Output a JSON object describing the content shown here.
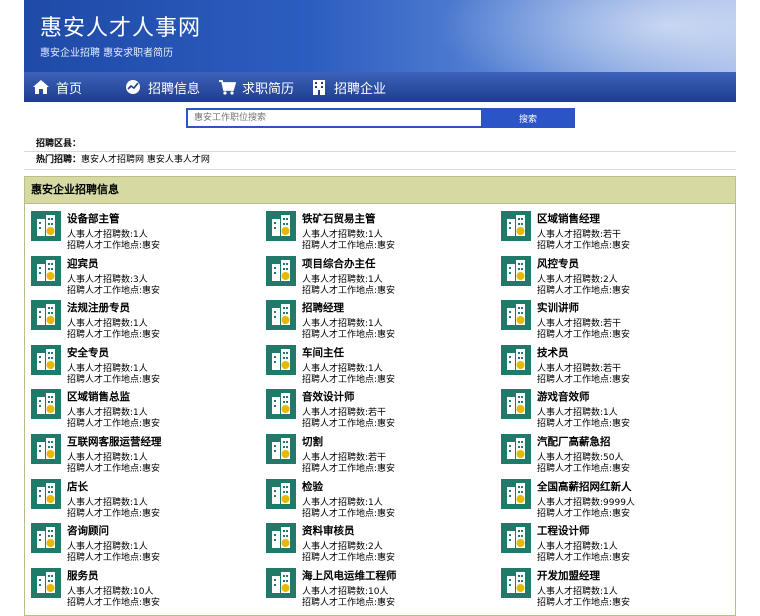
{
  "header": {
    "title": "惠安人才人事网",
    "subtitle": "惠安企业招聘 惠安求职者简历"
  },
  "nav": [
    {
      "label": "首页",
      "icon": "home-icon"
    },
    {
      "label": "招聘信息",
      "icon": "chart-icon"
    },
    {
      "label": "求职简历",
      "icon": "cart-icon"
    },
    {
      "label": "招聘企业",
      "icon": "building-icon"
    }
  ],
  "search": {
    "placeholder": "惠安工作职位搜索",
    "button": "搜索"
  },
  "filter": {
    "label": "招聘区县："
  },
  "hot": {
    "label": "热门招聘：",
    "links": [
      "惠安人才招聘网",
      "惠安人事人才网"
    ]
  },
  "panel": {
    "title": "惠安企业招聘信息"
  },
  "colors": {
    "accent": "#2b55c7",
    "nav": "#1e3d8f",
    "panel_head": "#d6daa2"
  },
  "jobs": [
    {
      "title": "设备部主管",
      "count": "人事人才招聘数:1人",
      "location": "招聘人才工作地点:惠安"
    },
    {
      "title": "铁矿石贸易主管",
      "count": "人事人才招聘数:1人",
      "location": "招聘人才工作地点:惠安"
    },
    {
      "title": "区域销售经理",
      "count": "人事人才招聘数:若干",
      "location": "招聘人才工作地点:惠安"
    },
    {
      "title": "迎宾员",
      "count": "人事人才招聘数:3人",
      "location": "招聘人才工作地点:惠安"
    },
    {
      "title": "项目综合办主任",
      "count": "人事人才招聘数:1人",
      "location": "招聘人才工作地点:惠安"
    },
    {
      "title": "风控专员",
      "count": "人事人才招聘数:2人",
      "location": "招聘人才工作地点:惠安"
    },
    {
      "title": "法规注册专员",
      "count": "人事人才招聘数:1人",
      "location": "招聘人才工作地点:惠安"
    },
    {
      "title": "招聘经理",
      "count": "人事人才招聘数:1人",
      "location": "招聘人才工作地点:惠安"
    },
    {
      "title": "实训讲师",
      "count": "人事人才招聘数:若干",
      "location": "招聘人才工作地点:惠安"
    },
    {
      "title": "安全专员",
      "count": "人事人才招聘数:1人",
      "location": "招聘人才工作地点:惠安"
    },
    {
      "title": "车间主任",
      "count": "人事人才招聘数:1人",
      "location": "招聘人才工作地点:惠安"
    },
    {
      "title": "技术员",
      "count": "人事人才招聘数:若干",
      "location": "招聘人才工作地点:惠安"
    },
    {
      "title": "区域销售总监",
      "count": "人事人才招聘数:1人",
      "location": "招聘人才工作地点:惠安"
    },
    {
      "title": "音效设计师",
      "count": "人事人才招聘数:若干",
      "location": "招聘人才工作地点:惠安"
    },
    {
      "title": "游戏音效师",
      "count": "人事人才招聘数:1人",
      "location": "招聘人才工作地点:惠安"
    },
    {
      "title": "互联网客服运营经理",
      "count": "人事人才招聘数:1人",
      "location": "招聘人才工作地点:惠安"
    },
    {
      "title": "切割",
      "count": "人事人才招聘数:若干",
      "location": "招聘人才工作地点:惠安"
    },
    {
      "title": "汽配厂高薪急招",
      "count": "人事人才招聘数:50人",
      "location": "招聘人才工作地点:惠安"
    },
    {
      "title": "店长",
      "count": "人事人才招聘数:1人",
      "location": "招聘人才工作地点:惠安"
    },
    {
      "title": "检验",
      "count": "人事人才招聘数:1人",
      "location": "招聘人才工作地点:惠安"
    },
    {
      "title": "全国高薪招网红新人",
      "count": "人事人才招聘数:9999人",
      "location": "招聘人才工作地点:惠安"
    },
    {
      "title": "咨询顾问",
      "count": "人事人才招聘数:1人",
      "location": "招聘人才工作地点:惠安"
    },
    {
      "title": "资料审核员",
      "count": "人事人才招聘数:2人",
      "location": "招聘人才工作地点:惠安"
    },
    {
      "title": "工程设计师",
      "count": "人事人才招聘数:1人",
      "location": "招聘人才工作地点:惠安"
    },
    {
      "title": "服务员",
      "count": "人事人才招聘数:10人",
      "location": "招聘人才工作地点:惠安"
    },
    {
      "title": "海上风电运维工程师",
      "count": "人事人才招聘数:10人",
      "location": "招聘人才工作地点:惠安"
    },
    {
      "title": "开发加盟经理",
      "count": "人事人才招聘数:1人",
      "location": "招聘人才工作地点:惠安"
    }
  ]
}
